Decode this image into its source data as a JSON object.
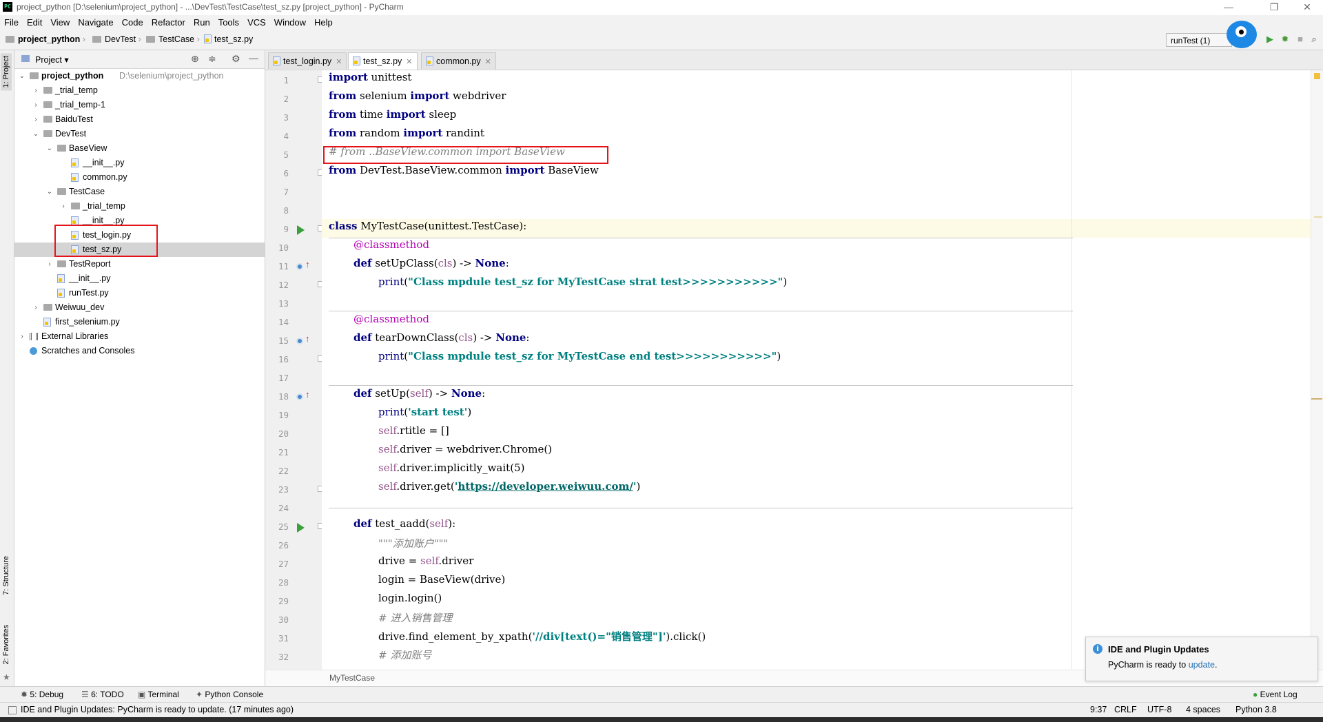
{
  "window": {
    "title": "project_python [D:\\selenium\\project_python] - ...\\DevTest\\TestCase\\test_sz.py [project_python] - PyCharm",
    "controls": {
      "minimize": "—",
      "restore": "❐",
      "close": "✕"
    }
  },
  "menu": [
    "File",
    "Edit",
    "View",
    "Navigate",
    "Code",
    "Refactor",
    "Run",
    "Tools",
    "VCS",
    "Window",
    "Help"
  ],
  "navbar": {
    "crumbs": [
      "project_python",
      "DevTest",
      "TestCase",
      "test_sz.py"
    ],
    "run_config": "runTest (1)"
  },
  "sidebar_tabs": {
    "project": "1: Project",
    "structure": "7: Structure",
    "favorites": "2: Favorites"
  },
  "project_panel": {
    "header": "Project",
    "tree": [
      {
        "label": "project_python",
        "sub": "D:\\selenium\\project_python",
        "type": "folder",
        "expanded": true,
        "bold": true
      },
      {
        "label": "_trial_temp",
        "type": "folder",
        "expanded": false
      },
      {
        "label": "_trial_temp-1",
        "type": "folder",
        "expanded": false
      },
      {
        "label": "BaiduTest",
        "type": "folder",
        "expanded": false
      },
      {
        "label": "DevTest",
        "type": "folder",
        "expanded": true
      },
      {
        "label": "BaseView",
        "type": "folder",
        "expanded": true
      },
      {
        "label": "__init__.py",
        "type": "file"
      },
      {
        "label": "common.py",
        "type": "file"
      },
      {
        "label": "TestCase",
        "type": "folder",
        "expanded": true
      },
      {
        "label": "_trial_temp",
        "type": "folder",
        "expanded": false
      },
      {
        "label": "__init__.py",
        "type": "file"
      },
      {
        "label": "test_login.py",
        "type": "file"
      },
      {
        "label": "test_sz.py",
        "type": "file",
        "selected": true
      },
      {
        "label": "TestReport",
        "type": "folder",
        "expanded": false
      },
      {
        "label": "__init__.py",
        "type": "file"
      },
      {
        "label": "runTest.py",
        "type": "file"
      },
      {
        "label": "Weiwuu_dev",
        "type": "folder",
        "expanded": false
      },
      {
        "label": "first_selenium.py",
        "type": "file"
      },
      {
        "label": "External Libraries",
        "type": "lib",
        "expanded": false
      },
      {
        "label": "Scratches and Consoles",
        "type": "scratch"
      }
    ]
  },
  "editor": {
    "tabs": [
      "test_login.py",
      "test_sz.py",
      "common.py"
    ],
    "active_tab": "test_sz.py",
    "line_numbers": [
      "1",
      "2",
      "3",
      "4",
      "5",
      "6",
      "7",
      "8",
      "9",
      "10",
      "11",
      "12",
      "13",
      "14",
      "15",
      "16",
      "17",
      "18",
      "19",
      "20",
      "21",
      "22",
      "23",
      "24",
      "25",
      "26",
      "27",
      "28",
      "29",
      "30",
      "31",
      "32"
    ],
    "breadcrumb": "MyTestCase",
    "code": {
      "l1": "import unittest",
      "l2": "from selenium import webdriver",
      "l3": "from time import sleep",
      "l4": "from random import randint",
      "l5": "# from ..BaseView.common import BaseView",
      "l6": "from DevTest.BaseView.common import BaseView",
      "l9": "class MyTestCase(unittest.TestCase):",
      "l10": "@classmethod",
      "l11": "def setUpClass(cls) -> None:",
      "l12": "print(\"Class mpdule test_sz for MyTestCase strat test>>>>>>>>>>>\")",
      "l14": "@classmethod",
      "l15": "def tearDownClass(cls) -> None:",
      "l16": "print(\"Class mpdule test_sz for MyTestCase end test>>>>>>>>>>>\")",
      "l18": "def setUp(self) -> None:",
      "l19": "print('start test')",
      "l20": "self.rtitle = []",
      "l21": "self.driver = webdriver.Chrome()",
      "l22": "self.driver.implicitly_wait(5)",
      "l23": "self.driver.get('https://developer.weiwuu.com/')",
      "l25": "def test_aadd(self):",
      "l26": "\"\"\"添加账户\"\"\"",
      "l27": "drive = self.driver",
      "l28": "login = BaseView(drive)",
      "l29": "login.login()",
      "l30": "# 进入销售管理",
      "l31": "drive.find_element_by_xpath('//div[text()=\"销售管理\"]').click()",
      "l32": "# 添加账号"
    }
  },
  "tool_windows": [
    "5: Debug",
    "6: TODO",
    "Terminal",
    "Python Console",
    "Event Log"
  ],
  "status": {
    "message": "IDE and Plugin Updates: PyCharm is ready to update. (17 minutes ago)",
    "position": "9:37",
    "line_sep": "CRLF",
    "encoding": "UTF-8",
    "indent": "4 spaces",
    "interpreter": "Python 3.8"
  },
  "notification": {
    "title": "IDE and Plugin Updates",
    "body": "PyCharm is ready to",
    "link": "update",
    "suffix": "."
  },
  "colors": {
    "highlight_box": "#e5141b",
    "run_gutter": "#3aa13a",
    "keyword": "#000080",
    "string": "#008080"
  }
}
